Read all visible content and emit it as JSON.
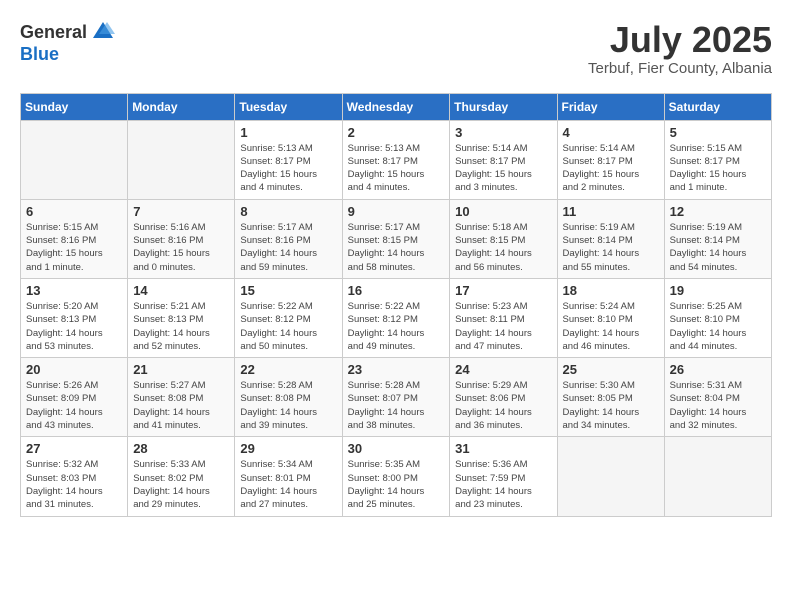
{
  "header": {
    "logo_general": "General",
    "logo_blue": "Blue",
    "month": "July 2025",
    "location": "Terbuf, Fier County, Albania"
  },
  "days_of_week": [
    "Sunday",
    "Monday",
    "Tuesday",
    "Wednesday",
    "Thursday",
    "Friday",
    "Saturday"
  ],
  "weeks": [
    [
      {
        "num": "",
        "info": ""
      },
      {
        "num": "",
        "info": ""
      },
      {
        "num": "1",
        "info": "Sunrise: 5:13 AM\nSunset: 8:17 PM\nDaylight: 15 hours\nand 4 minutes."
      },
      {
        "num": "2",
        "info": "Sunrise: 5:13 AM\nSunset: 8:17 PM\nDaylight: 15 hours\nand 4 minutes."
      },
      {
        "num": "3",
        "info": "Sunrise: 5:14 AM\nSunset: 8:17 PM\nDaylight: 15 hours\nand 3 minutes."
      },
      {
        "num": "4",
        "info": "Sunrise: 5:14 AM\nSunset: 8:17 PM\nDaylight: 15 hours\nand 2 minutes."
      },
      {
        "num": "5",
        "info": "Sunrise: 5:15 AM\nSunset: 8:17 PM\nDaylight: 15 hours\nand 1 minute."
      }
    ],
    [
      {
        "num": "6",
        "info": "Sunrise: 5:15 AM\nSunset: 8:16 PM\nDaylight: 15 hours\nand 1 minute."
      },
      {
        "num": "7",
        "info": "Sunrise: 5:16 AM\nSunset: 8:16 PM\nDaylight: 15 hours\nand 0 minutes."
      },
      {
        "num": "8",
        "info": "Sunrise: 5:17 AM\nSunset: 8:16 PM\nDaylight: 14 hours\nand 59 minutes."
      },
      {
        "num": "9",
        "info": "Sunrise: 5:17 AM\nSunset: 8:15 PM\nDaylight: 14 hours\nand 58 minutes."
      },
      {
        "num": "10",
        "info": "Sunrise: 5:18 AM\nSunset: 8:15 PM\nDaylight: 14 hours\nand 56 minutes."
      },
      {
        "num": "11",
        "info": "Sunrise: 5:19 AM\nSunset: 8:14 PM\nDaylight: 14 hours\nand 55 minutes."
      },
      {
        "num": "12",
        "info": "Sunrise: 5:19 AM\nSunset: 8:14 PM\nDaylight: 14 hours\nand 54 minutes."
      }
    ],
    [
      {
        "num": "13",
        "info": "Sunrise: 5:20 AM\nSunset: 8:13 PM\nDaylight: 14 hours\nand 53 minutes."
      },
      {
        "num": "14",
        "info": "Sunrise: 5:21 AM\nSunset: 8:13 PM\nDaylight: 14 hours\nand 52 minutes."
      },
      {
        "num": "15",
        "info": "Sunrise: 5:22 AM\nSunset: 8:12 PM\nDaylight: 14 hours\nand 50 minutes."
      },
      {
        "num": "16",
        "info": "Sunrise: 5:22 AM\nSunset: 8:12 PM\nDaylight: 14 hours\nand 49 minutes."
      },
      {
        "num": "17",
        "info": "Sunrise: 5:23 AM\nSunset: 8:11 PM\nDaylight: 14 hours\nand 47 minutes."
      },
      {
        "num": "18",
        "info": "Sunrise: 5:24 AM\nSunset: 8:10 PM\nDaylight: 14 hours\nand 46 minutes."
      },
      {
        "num": "19",
        "info": "Sunrise: 5:25 AM\nSunset: 8:10 PM\nDaylight: 14 hours\nand 44 minutes."
      }
    ],
    [
      {
        "num": "20",
        "info": "Sunrise: 5:26 AM\nSunset: 8:09 PM\nDaylight: 14 hours\nand 43 minutes."
      },
      {
        "num": "21",
        "info": "Sunrise: 5:27 AM\nSunset: 8:08 PM\nDaylight: 14 hours\nand 41 minutes."
      },
      {
        "num": "22",
        "info": "Sunrise: 5:28 AM\nSunset: 8:08 PM\nDaylight: 14 hours\nand 39 minutes."
      },
      {
        "num": "23",
        "info": "Sunrise: 5:28 AM\nSunset: 8:07 PM\nDaylight: 14 hours\nand 38 minutes."
      },
      {
        "num": "24",
        "info": "Sunrise: 5:29 AM\nSunset: 8:06 PM\nDaylight: 14 hours\nand 36 minutes."
      },
      {
        "num": "25",
        "info": "Sunrise: 5:30 AM\nSunset: 8:05 PM\nDaylight: 14 hours\nand 34 minutes."
      },
      {
        "num": "26",
        "info": "Sunrise: 5:31 AM\nSunset: 8:04 PM\nDaylight: 14 hours\nand 32 minutes."
      }
    ],
    [
      {
        "num": "27",
        "info": "Sunrise: 5:32 AM\nSunset: 8:03 PM\nDaylight: 14 hours\nand 31 minutes."
      },
      {
        "num": "28",
        "info": "Sunrise: 5:33 AM\nSunset: 8:02 PM\nDaylight: 14 hours\nand 29 minutes."
      },
      {
        "num": "29",
        "info": "Sunrise: 5:34 AM\nSunset: 8:01 PM\nDaylight: 14 hours\nand 27 minutes."
      },
      {
        "num": "30",
        "info": "Sunrise: 5:35 AM\nSunset: 8:00 PM\nDaylight: 14 hours\nand 25 minutes."
      },
      {
        "num": "31",
        "info": "Sunrise: 5:36 AM\nSunset: 7:59 PM\nDaylight: 14 hours\nand 23 minutes."
      },
      {
        "num": "",
        "info": ""
      },
      {
        "num": "",
        "info": ""
      }
    ]
  ]
}
